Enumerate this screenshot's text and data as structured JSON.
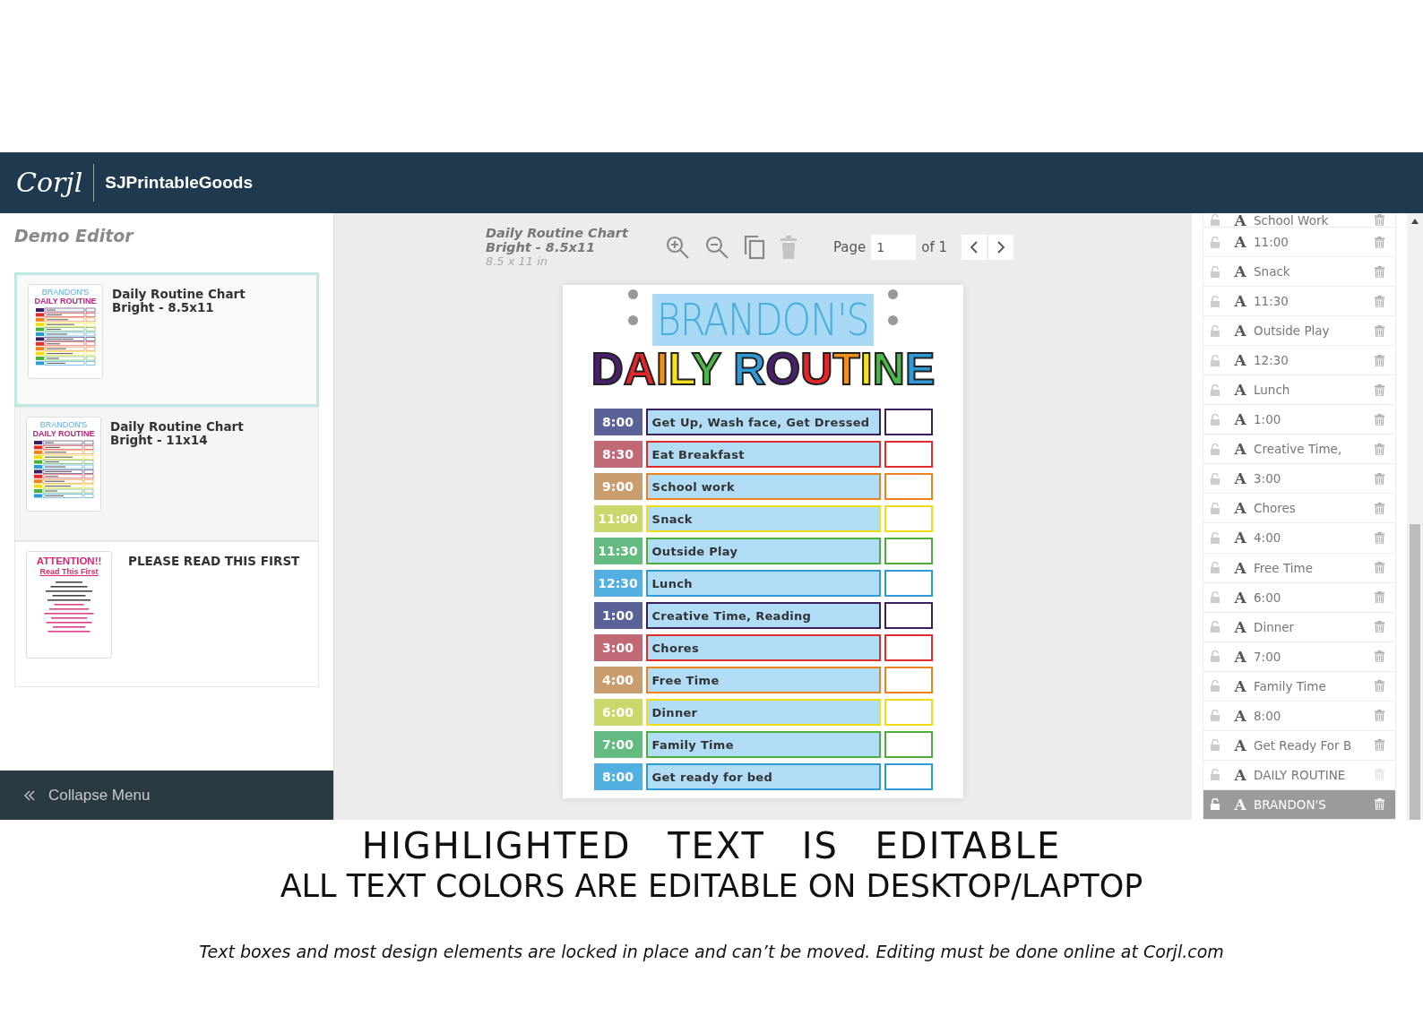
{
  "header": {
    "logo": "Corjl",
    "shop": "SJPrintableGoods"
  },
  "sidebar": {
    "title": "Demo Editor",
    "collapse": "Collapse Menu",
    "designs": [
      {
        "title": "Daily Routine Chart Bright - 8.5x11",
        "selected": true,
        "thumb": {
          "kind": "routine",
          "line1": "BRANDON'S",
          "line2": "DAILY ROUTINE"
        }
      },
      {
        "title": "Daily Routine Chart Bright - 11x14",
        "selected": false,
        "thumb": {
          "kind": "routine",
          "line1": "BRANDON'S",
          "line2": "DAILY ROUTINE"
        }
      },
      {
        "title": "PLEASE READ THIS FIRST",
        "selected": false,
        "thumb": {
          "kind": "notice",
          "line1": "ATTENTION!!",
          "line2": "Read This First"
        }
      }
    ]
  },
  "editor": {
    "doc_title": "Daily Routine Chart Bright - 8.5x11",
    "doc_size": "8.5 x 11 in",
    "delete_disabled": true,
    "page_label": "Page",
    "page": "1",
    "page_of": "of 1"
  },
  "document": {
    "name": "BRANDON'S",
    "name_selected": true,
    "title": "DAILY ROUTINE",
    "rows": [
      {
        "time": "8:00",
        "task": "Get Up, Wash face, Get Dressed",
        "color": "#3b1f5e",
        "checked": false
      },
      {
        "time": "8:30",
        "task": "Eat Breakfast",
        "color": "#e32b2b",
        "checked": false
      },
      {
        "time": "9:00",
        "task": "School work",
        "color": "#f07f1e",
        "checked": false
      },
      {
        "time": "11:00",
        "task": "Snack",
        "color": "#f2dc16",
        "checked": false
      },
      {
        "time": "11:30",
        "task": "Outside Play",
        "color": "#4caf3b",
        "checked": false
      },
      {
        "time": "12:30",
        "task": "Lunch",
        "color": "#2d9bd8",
        "checked": false
      },
      {
        "time": "1:00",
        "task": "Creative Time, Reading",
        "color": "#3b1f5e",
        "checked": false
      },
      {
        "time": "3:00",
        "task": "Chores",
        "color": "#e32b2b",
        "checked": false
      },
      {
        "time": "4:00",
        "task": "Free Time",
        "color": "#f07f1e",
        "checked": false
      },
      {
        "time": "6:00",
        "task": "Dinner",
        "color": "#f2dc16",
        "checked": false
      },
      {
        "time": "7:00",
        "task": "Family Time",
        "color": "#4caf3b",
        "checked": false
      },
      {
        "time": "8:00",
        "task": "Get ready for bed",
        "color": "#2d9bd8",
        "checked": false
      }
    ]
  },
  "layers": [
    {
      "type": "A",
      "label": "School Work",
      "selected": false,
      "delete_disabled": false
    },
    {
      "type": "A",
      "label": "11:00",
      "selected": false,
      "delete_disabled": false
    },
    {
      "type": "A",
      "label": "Snack",
      "selected": false,
      "delete_disabled": false
    },
    {
      "type": "A",
      "label": "11:30",
      "selected": false,
      "delete_disabled": false
    },
    {
      "type": "A",
      "label": "Outside Play",
      "selected": false,
      "delete_disabled": false
    },
    {
      "type": "A",
      "label": "12:30",
      "selected": false,
      "delete_disabled": false
    },
    {
      "type": "A",
      "label": "Lunch",
      "selected": false,
      "delete_disabled": false
    },
    {
      "type": "A",
      "label": "1:00",
      "selected": false,
      "delete_disabled": false
    },
    {
      "type": "A",
      "label": "Creative Time,",
      "selected": false,
      "delete_disabled": false
    },
    {
      "type": "A",
      "label": "3:00",
      "selected": false,
      "delete_disabled": false
    },
    {
      "type": "A",
      "label": "Chores",
      "selected": false,
      "delete_disabled": false
    },
    {
      "type": "A",
      "label": "4:00",
      "selected": false,
      "delete_disabled": false
    },
    {
      "type": "A",
      "label": "Free Time",
      "selected": false,
      "delete_disabled": false
    },
    {
      "type": "A",
      "label": "6:00",
      "selected": false,
      "delete_disabled": false
    },
    {
      "type": "A",
      "label": "Dinner",
      "selected": false,
      "delete_disabled": false
    },
    {
      "type": "A",
      "label": "7:00",
      "selected": false,
      "delete_disabled": false
    },
    {
      "type": "A",
      "label": "Family Time",
      "selected": false,
      "delete_disabled": false
    },
    {
      "type": "A",
      "label": "8:00",
      "selected": false,
      "delete_disabled": false
    },
    {
      "type": "A",
      "label": "Get Ready For B",
      "selected": false,
      "delete_disabled": false
    },
    {
      "type": "A",
      "label": "DAILY ROUTINE",
      "selected": false,
      "delete_disabled": true
    },
    {
      "type": "A",
      "label": "BRANDON'S",
      "selected": true,
      "delete_disabled": false
    }
  ],
  "caption": {
    "headline": "HIGHLIGHTED TEXT IS EDITABLE",
    "subline": "ALL TEXT COLORS ARE EDITABLE ON DESKTOP/LAPTOP",
    "note": "Text boxes and most design elements are locked in place and can’t be moved. Editing must be done online at Corjl.com"
  }
}
